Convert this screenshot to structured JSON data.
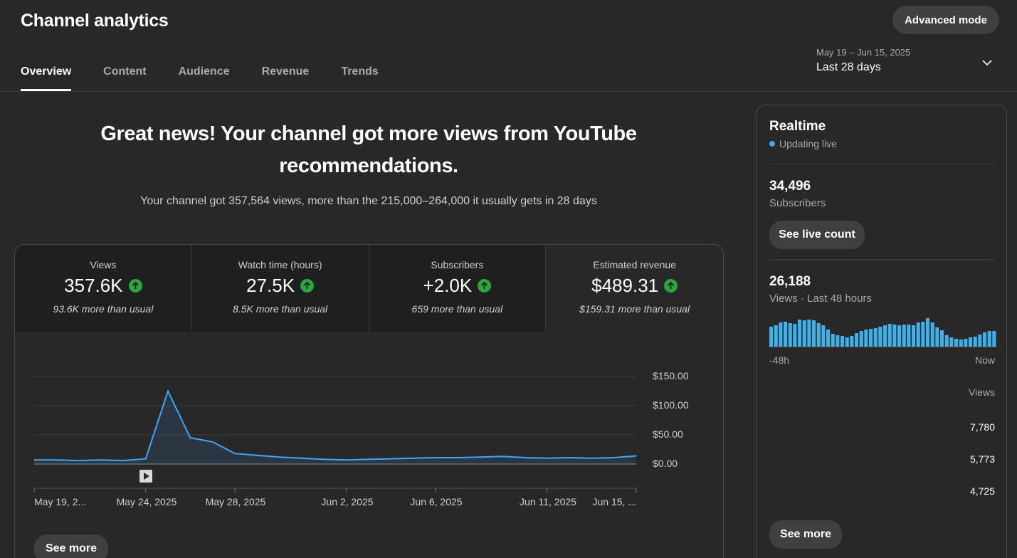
{
  "header": {
    "title": "Channel analytics",
    "advanced_label": "Advanced mode"
  },
  "tabs": [
    {
      "label": "Overview",
      "active": true
    },
    {
      "label": "Content"
    },
    {
      "label": "Audience"
    },
    {
      "label": "Revenue"
    },
    {
      "label": "Trends"
    }
  ],
  "date": {
    "range": "May 19 – Jun 15, 2025",
    "label": "Last 28 days"
  },
  "headline": "Great news! Your channel got more views from YouTube recommendations.",
  "subline": "Your channel got 357,564 views, more than the 215,000–264,000 it usually gets in 28 days",
  "metrics": [
    {
      "label": "Views",
      "value": "357.6K",
      "note": "93.6K more than usual"
    },
    {
      "label": "Watch time (hours)",
      "value": "27.5K",
      "note": "8.5K more than usual"
    },
    {
      "label": "Subscribers",
      "value": "+2.0K",
      "note": "659 more than usual"
    },
    {
      "label": "Estimated revenue",
      "value": "$489.31",
      "note": "$159.31 more than usual"
    }
  ],
  "see_more_label": "See more",
  "chart_data": {
    "type": "area",
    "y_ticks": [
      "$150.00",
      "$100.00",
      "$50.00",
      "$0.00"
    ],
    "ylim": [
      0,
      150
    ],
    "x_labels": [
      "May 19, 2...",
      "May 24, 2025",
      "May 28, 2025",
      "Jun 2, 2025",
      "Jun 6, 2025",
      "Jun 11, 2025",
      "Jun 15, ..."
    ],
    "x": [
      "May 19",
      "May 20",
      "May 21",
      "May 22",
      "May 23",
      "May 24",
      "May 25",
      "May 26",
      "May 27",
      "May 28",
      "May 29",
      "May 30",
      "May 31",
      "Jun 1",
      "Jun 2",
      "Jun 3",
      "Jun 4",
      "Jun 5",
      "Jun 6",
      "Jun 7",
      "Jun 8",
      "Jun 9",
      "Jun 10",
      "Jun 11",
      "Jun 12",
      "Jun 13",
      "Jun 14",
      "Jun 15"
    ],
    "values": [
      7,
      7,
      6,
      7,
      6,
      9,
      125,
      45,
      38,
      18,
      15,
      12,
      10,
      8,
      7,
      8,
      9,
      10,
      11,
      11,
      12,
      13,
      11,
      10,
      11,
      10,
      11,
      14
    ],
    "color": "#3ea6ff"
  },
  "realtime": {
    "title": "Realtime",
    "live_label": "Updating live",
    "subscribers_value": "34,496",
    "subscribers_label": "Subscribers",
    "live_count_label": "See live count",
    "views_value": "26,188",
    "views_label": "Views · Last 48 hours",
    "axis_start": "-48h",
    "axis_end": "Now",
    "column_header": "Views",
    "top_counts": [
      "7,780",
      "5,773",
      "4,725"
    ],
    "see_more_label": "See more",
    "bar_values": [
      28,
      30,
      34,
      35,
      33,
      32,
      38,
      37,
      38,
      37,
      33,
      30,
      24,
      18,
      16,
      15,
      13,
      15,
      19,
      22,
      24,
      25,
      26,
      28,
      30,
      32,
      31,
      30,
      31,
      31,
      30,
      34,
      35,
      40,
      34,
      27,
      23,
      16,
      13,
      11,
      10,
      11,
      13,
      14,
      17,
      20,
      22,
      22
    ]
  },
  "colors": {
    "accent": "#3ea6ff",
    "up": "#2ba640",
    "background": "#282828"
  }
}
